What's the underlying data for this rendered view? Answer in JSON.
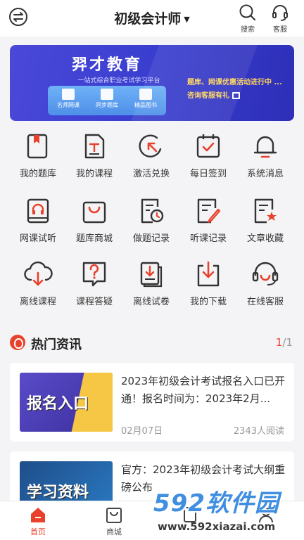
{
  "header": {
    "title": "初级会计师",
    "search_label": "搜索",
    "service_label": "客服"
  },
  "banner": {
    "brand": "羿才教育",
    "slogan": "一站式综合职业考试学习平台",
    "items": [
      "名师网课",
      "同步题库",
      "精品图书"
    ],
    "promo_line1": "题库、网课优惠活动进行中 ...",
    "promo_line2": "咨询客服有礼"
  },
  "grid": {
    "items": [
      {
        "label": "我的题库",
        "icon": "question-bank-icon"
      },
      {
        "label": "我的课程",
        "icon": "course-icon"
      },
      {
        "label": "激活兑换",
        "icon": "activate-icon"
      },
      {
        "label": "每日签到",
        "icon": "checkin-icon"
      },
      {
        "label": "系统消息",
        "icon": "bell-icon"
      },
      {
        "label": "网课试听",
        "icon": "audition-icon"
      },
      {
        "label": "题库商城",
        "icon": "shop-bag-icon"
      },
      {
        "label": "做题记录",
        "icon": "practice-record-icon"
      },
      {
        "label": "听课记录",
        "icon": "listen-record-icon"
      },
      {
        "label": "文章收藏",
        "icon": "favorite-article-icon"
      },
      {
        "label": "离线课程",
        "icon": "cloud-download-icon"
      },
      {
        "label": "课程答疑",
        "icon": "qa-icon"
      },
      {
        "label": "离线试卷",
        "icon": "offline-paper-icon"
      },
      {
        "label": "我的下载",
        "icon": "download-icon"
      },
      {
        "label": "在线客服",
        "icon": "headset-icon"
      }
    ]
  },
  "news": {
    "title": "热门资讯",
    "page_current": "1",
    "page_total": "/1",
    "articles": [
      {
        "thumb_text": "报名入口",
        "title": "2023年初级会计考试报名入口已开通！报名时间为：2023年2月...",
        "date": "02月07日",
        "reads": "2343人阅读"
      },
      {
        "thumb_text": "学习资料",
        "title": "官方：2023年初级会计考试大纲重磅公布",
        "date": "",
        "reads": ""
      }
    ]
  },
  "tabbar": {
    "items": [
      {
        "label": "首页",
        "active": true
      },
      {
        "label": "商城",
        "active": false
      },
      {
        "label": "",
        "active": false
      },
      {
        "label": "",
        "active": false
      }
    ]
  },
  "watermark": {
    "big": "592软件园",
    "url": "www.592xiazai.com"
  },
  "colors": {
    "accent": "#e8412c",
    "banner": "#3b3fd0",
    "promo": "#ffd45a"
  }
}
